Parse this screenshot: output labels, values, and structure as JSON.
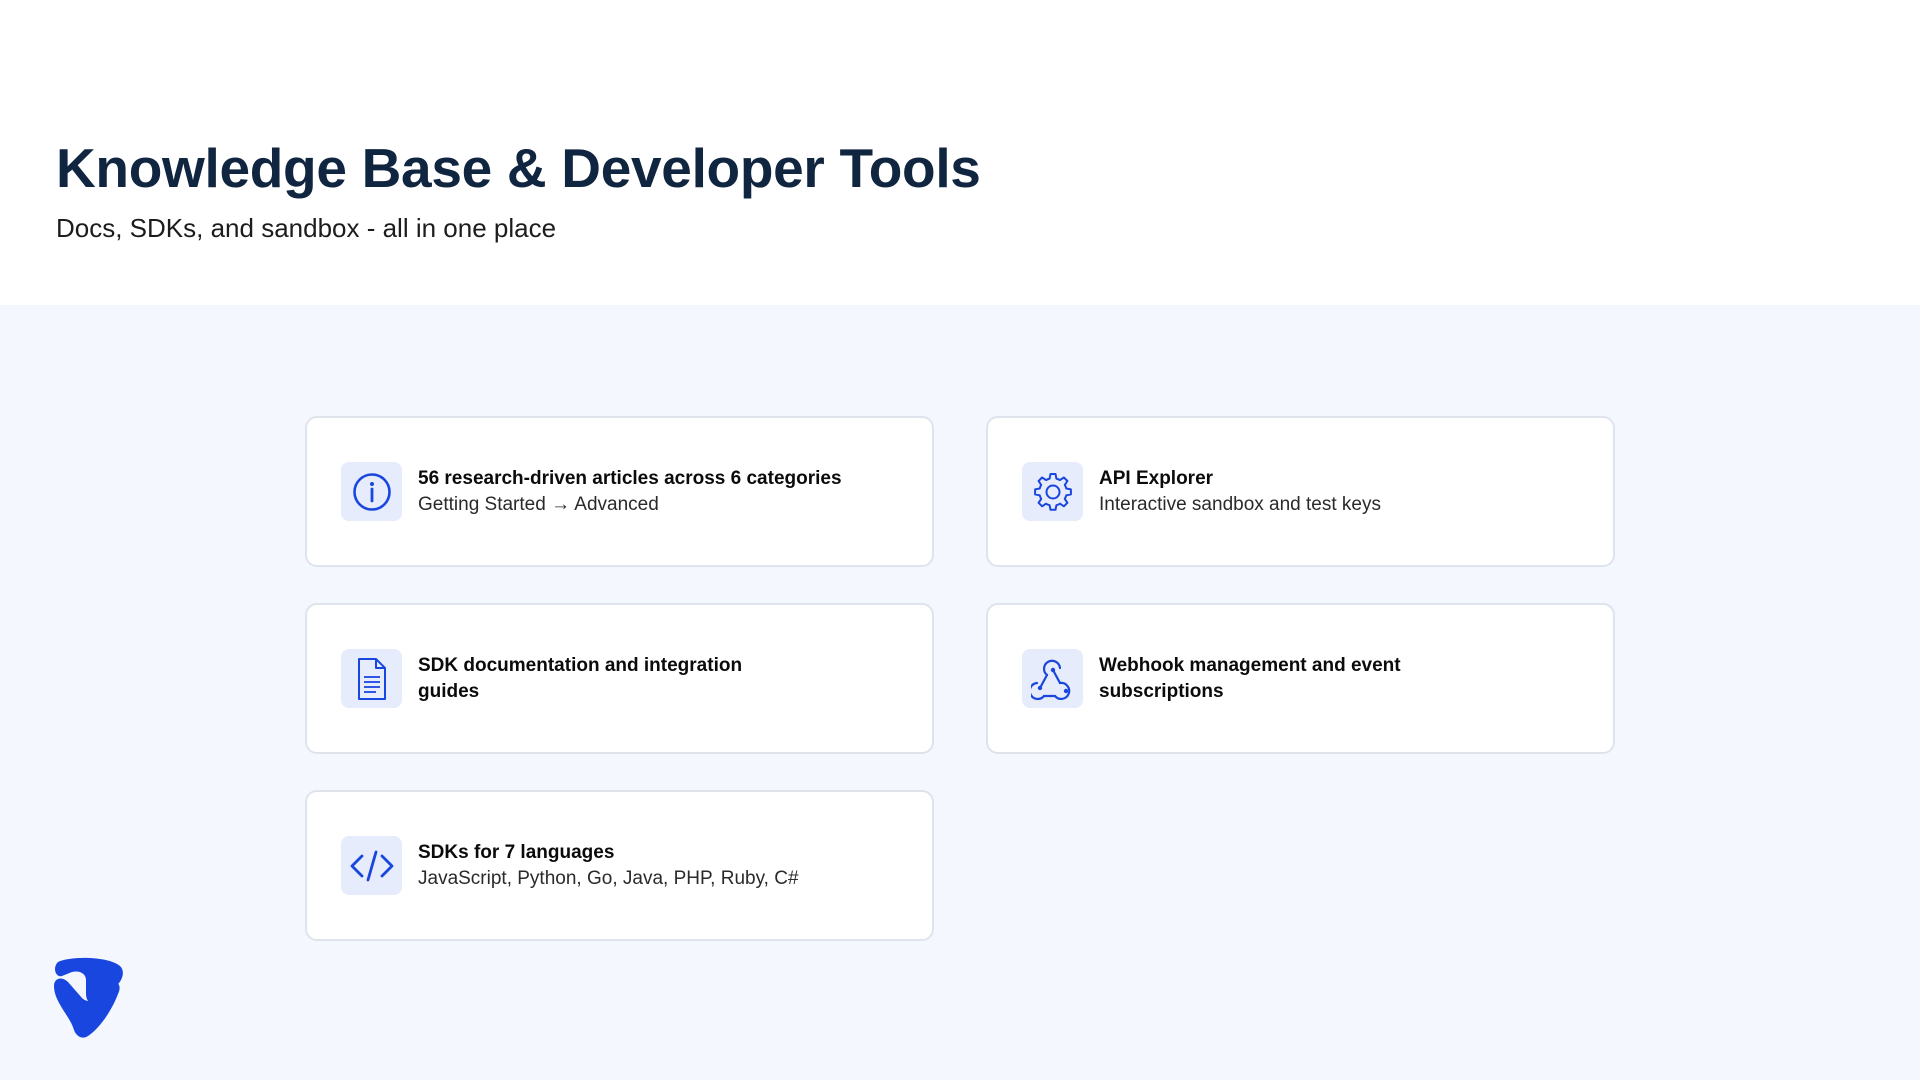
{
  "header": {
    "title": "Knowledge Base & Developer Tools",
    "subtitle": "Docs, SDKs, and sandbox - all in one place"
  },
  "cards": [
    {
      "icon": "info-icon",
      "title": "56 research-driven articles across 6 categories",
      "subtitle": "Getting Started → Advanced"
    },
    {
      "icon": "gear-icon",
      "title": "API Explorer",
      "subtitle": "Interactive sandbox and test keys"
    },
    {
      "icon": "document-icon",
      "title": "SDK documentation and integration guides",
      "subtitle": ""
    },
    {
      "icon": "webhook-icon",
      "title": "Webhook management and event subscriptions",
      "subtitle": ""
    },
    {
      "icon": "code-icon",
      "title": "SDKs for 7 languages",
      "subtitle": "JavaScript, Python, Go, Java, PHP, Ruby, C#"
    }
  ],
  "colors": {
    "accent": "#1a46e0",
    "title": "#10253f",
    "content_bg": "#f4f7fd",
    "icon_bg": "#e6ecfb",
    "card_border": "#dfe3ec"
  },
  "logo": "brand-logo-icon"
}
